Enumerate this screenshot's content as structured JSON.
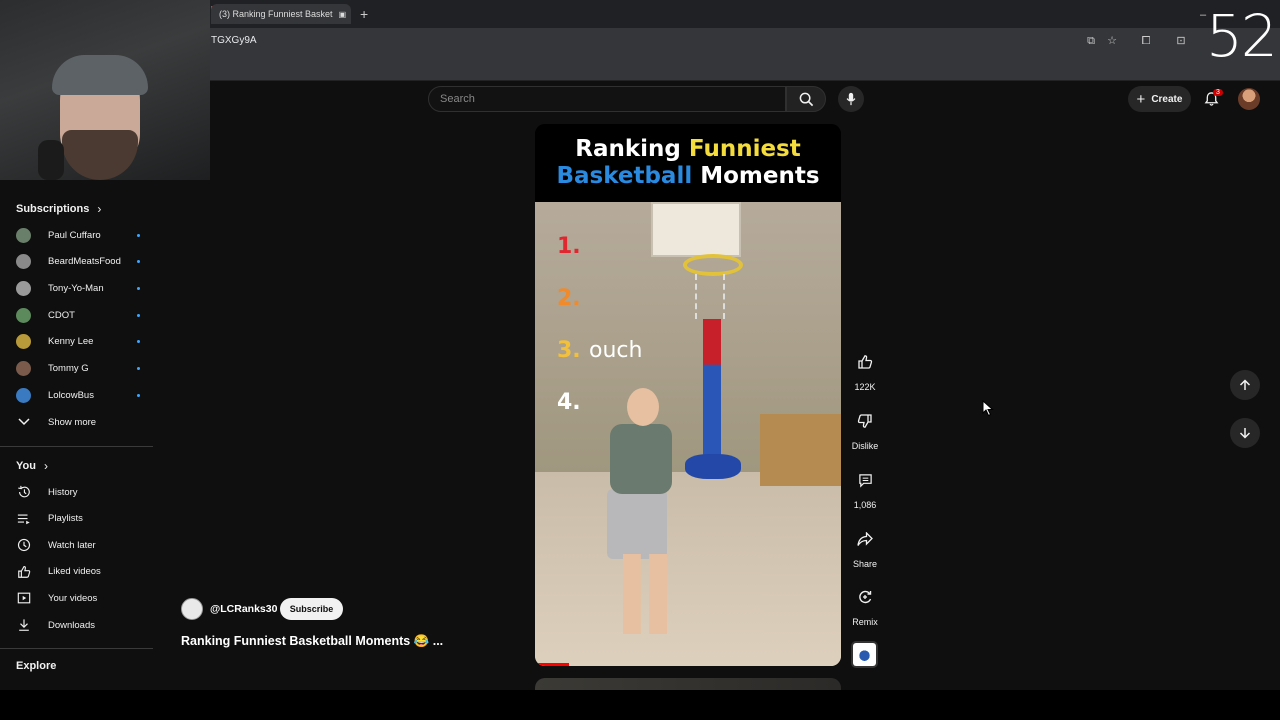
{
  "browser": {
    "tab_title": "(3) Ranking Funniest Basket",
    "url": "TGXGy9A",
    "counter_overlay": "52"
  },
  "header": {
    "search_placeholder": "Search",
    "create_label": "Create",
    "notification_count": "3"
  },
  "sidebar": {
    "subscriptions_label": "Subscriptions",
    "subscriptions": [
      {
        "name": "Paul Cuffaro",
        "color": "#6a7f6a"
      },
      {
        "name": "BeardMeatsFood",
        "color": "#8a8a8a"
      },
      {
        "name": "Tony-Yo-Man",
        "color": "#9a9a9a"
      },
      {
        "name": "CDOT",
        "color": "#5c8a5c"
      },
      {
        "name": "Kenny Lee",
        "color": "#b89a3a"
      },
      {
        "name": "Tommy G",
        "color": "#7a5a4a"
      },
      {
        "name": "LolcowBus",
        "color": "#3a7ac0"
      }
    ],
    "show_more_label": "Show more",
    "you_label": "You",
    "you_items": [
      {
        "label": "History",
        "icon": "history-icon"
      },
      {
        "label": "Playlists",
        "icon": "playlists-icon"
      },
      {
        "label": "Watch later",
        "icon": "watch-later-icon"
      },
      {
        "label": "Liked videos",
        "icon": "liked-videos-icon"
      },
      {
        "label": "Your videos",
        "icon": "your-videos-icon"
      },
      {
        "label": "Downloads",
        "icon": "downloads-icon"
      }
    ],
    "explore_label": "Explore"
  },
  "video": {
    "overlay_title_line1_a": "Ranking ",
    "overlay_title_line1_b": "Funniest",
    "overlay_title_line2_a": "Basketball",
    "overlay_title_line2_b": " Moments",
    "ranks": [
      "1.",
      "2.",
      "3.",
      "4."
    ],
    "rank3_caption": "ouch",
    "colors": {
      "funniest": "#f3dc3c",
      "basketball": "#2a8ae0",
      "rank1": "#e0262e",
      "rank2": "#f08a2a",
      "rank3": "#f3c03c",
      "rank4": "#ffffff"
    },
    "progress": 0.11
  },
  "actions": {
    "like_count": "122K",
    "dislike_label": "Dislike",
    "comment_count": "1,086",
    "share_label": "Share",
    "remix_label": "Remix"
  },
  "channel": {
    "handle": "@LCRanks30",
    "subscribe_label": "Subscribe",
    "video_title": "Ranking Funniest Basketball Moments 😂 ..."
  }
}
